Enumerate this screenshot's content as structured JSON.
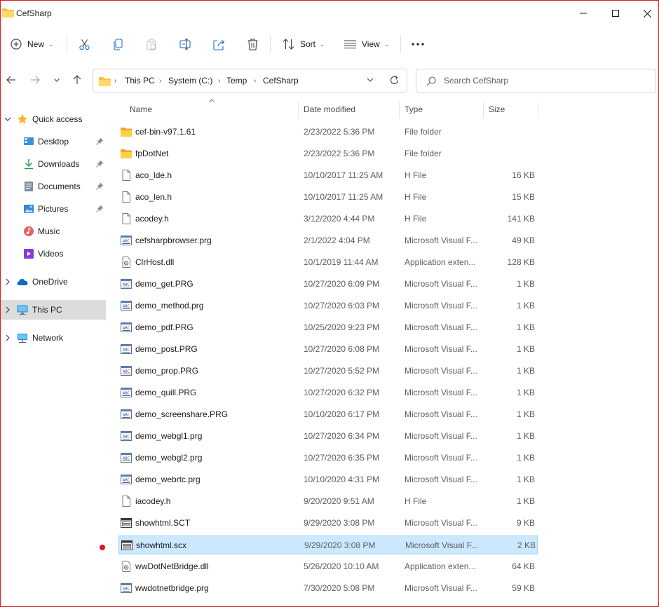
{
  "window": {
    "title": "CefSharp"
  },
  "toolbar": {
    "new_label": "New",
    "sort_label": "Sort",
    "view_label": "View"
  },
  "address": {
    "crumbs": [
      "This PC",
      "System (C:)",
      "Temp",
      "CefSharp"
    ]
  },
  "search": {
    "placeholder": "Search CefSharp"
  },
  "nav": {
    "quick_access": "Quick access",
    "desktop": "Desktop",
    "downloads": "Downloads",
    "documents": "Documents",
    "pictures": "Pictures",
    "music": "Music",
    "videos": "Videos",
    "onedrive": "OneDrive",
    "this_pc": "This PC",
    "network": "Network"
  },
  "columns": {
    "name": "Name",
    "date": "Date modified",
    "type": "Type",
    "size": "Size"
  },
  "files": [
    {
      "name": "cef-bin-v97.1.61",
      "date": "2/23/2022 5:36 PM",
      "type": "File folder",
      "size": "",
      "icon": "folder-icon"
    },
    {
      "name": "fpDotNet",
      "date": "2/23/2022 5:36 PM",
      "type": "File folder",
      "size": "",
      "icon": "folder-icon"
    },
    {
      "name": "aco_lde.h",
      "date": "10/10/2017 11:25 AM",
      "type": "H File",
      "size": "16 KB",
      "icon": "document-icon"
    },
    {
      "name": "aco_len.h",
      "date": "10/10/2017 11:25 AM",
      "type": "H File",
      "size": "15 KB",
      "icon": "document-icon"
    },
    {
      "name": "acodey.h",
      "date": "3/12/2020 4:44 PM",
      "type": "H File",
      "size": "141 KB",
      "icon": "document-icon"
    },
    {
      "name": "cefsharpbrowser.prg",
      "date": "2/1/2022 4:04 PM",
      "type": "Microsoft Visual F...",
      "size": "49 KB",
      "icon": "program-file-icon"
    },
    {
      "name": "ClrHost.dll",
      "date": "10/1/2019 11:44 AM",
      "type": "Application exten...",
      "size": "128 KB",
      "icon": "dll-icon"
    },
    {
      "name": "demo_get.PRG",
      "date": "10/27/2020 6:09 PM",
      "type": "Microsoft Visual F...",
      "size": "1 KB",
      "icon": "program-file-icon"
    },
    {
      "name": "demo_method.prg",
      "date": "10/27/2020 6:03 PM",
      "type": "Microsoft Visual F...",
      "size": "1 KB",
      "icon": "program-file-icon"
    },
    {
      "name": "demo_pdf.PRG",
      "date": "10/25/2020 9:23 PM",
      "type": "Microsoft Visual F...",
      "size": "1 KB",
      "icon": "program-file-icon"
    },
    {
      "name": "demo_post.PRG",
      "date": "10/27/2020 6:08 PM",
      "type": "Microsoft Visual F...",
      "size": "1 KB",
      "icon": "program-file-icon"
    },
    {
      "name": "demo_prop.PRG",
      "date": "10/27/2020 5:52 PM",
      "type": "Microsoft Visual F...",
      "size": "1 KB",
      "icon": "program-file-icon"
    },
    {
      "name": "demo_quill.PRG",
      "date": "10/27/2020 6:32 PM",
      "type": "Microsoft Visual F...",
      "size": "1 KB",
      "icon": "program-file-icon"
    },
    {
      "name": "demo_screenshare.PRG",
      "date": "10/10/2020 6:17 PM",
      "type": "Microsoft Visual F...",
      "size": "1 KB",
      "icon": "program-file-icon"
    },
    {
      "name": "demo_webgl1.prg",
      "date": "10/27/2020 6:34 PM",
      "type": "Microsoft Visual F...",
      "size": "1 KB",
      "icon": "program-file-icon"
    },
    {
      "name": "demo_webgl2.prg",
      "date": "10/27/2020 6:35 PM",
      "type": "Microsoft Visual F...",
      "size": "1 KB",
      "icon": "program-file-icon"
    },
    {
      "name": "demo_webrtc.prg",
      "date": "10/10/2020 4:31 PM",
      "type": "Microsoft Visual F...",
      "size": "1 KB",
      "icon": "program-file-icon"
    },
    {
      "name": "iacodey.h",
      "date": "9/20/2020 9:51 AM",
      "type": "H File",
      "size": "1 KB",
      "icon": "document-icon"
    },
    {
      "name": "showhtml.SCT",
      "date": "9/29/2020 3:08 PM",
      "type": "Microsoft Visual F...",
      "size": "9 KB",
      "icon": "form-file-icon"
    },
    {
      "name": "showhtml.scx",
      "date": "9/29/2020 3:08 PM",
      "type": "Microsoft Visual F...",
      "size": "2 KB",
      "icon": "form-file-icon",
      "selected": true
    },
    {
      "name": "wwDotNetBridge.dll",
      "date": "5/26/2020 10:10 AM",
      "type": "Application exten...",
      "size": "64 KB",
      "icon": "dll-icon"
    },
    {
      "name": "wwdotnetbridge.prg",
      "date": "7/30/2020 5:08 PM",
      "type": "Microsoft Visual F...",
      "size": "59 KB",
      "icon": "program-file-icon"
    }
  ],
  "colors": {
    "accent": "#0067c0",
    "selection_bg": "#cce8ff",
    "selection_border": "#99d1ff",
    "folder": "#f8c33e",
    "window_border": "#e0161b"
  }
}
